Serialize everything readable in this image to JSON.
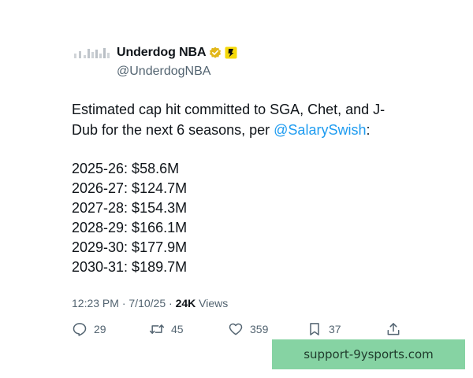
{
  "tweet": {
    "display_name": "Underdog NBA",
    "handle": "@UnderdogNBA",
    "text_before": "Estimated cap hit committed to SGA, Chet, and J-Dub for the next 6 seasons, per ",
    "mention": "@SalarySwish",
    "text_after": ":",
    "seasons": [
      "2025-26: $58.6M",
      "2026-27: $124.7M",
      "2027-28: $154.3M",
      "2028-29: $166.1M",
      "2029-30: $177.9M",
      "2030-31: $189.7M"
    ],
    "time": "12:23 PM",
    "date": "7/10/25",
    "views_count": "24K",
    "views_label": "Views",
    "replies": "29",
    "reposts": "45",
    "likes": "359",
    "bookmarks": "37"
  },
  "watermark": "support-9ysports.com",
  "icons": {
    "verified": "verified-badge-icon",
    "affiliate": "affiliate-logo-icon",
    "reply": "reply-icon",
    "repost": "repost-icon",
    "like": "heart-icon",
    "bookmark": "bookmark-icon",
    "share": "share-icon"
  },
  "colors": {
    "text": "#0f1419",
    "secondary": "#536471",
    "link": "#1d9bf0",
    "verified_gold": "#e2b719",
    "watermark_bg": "#86d3a3"
  }
}
